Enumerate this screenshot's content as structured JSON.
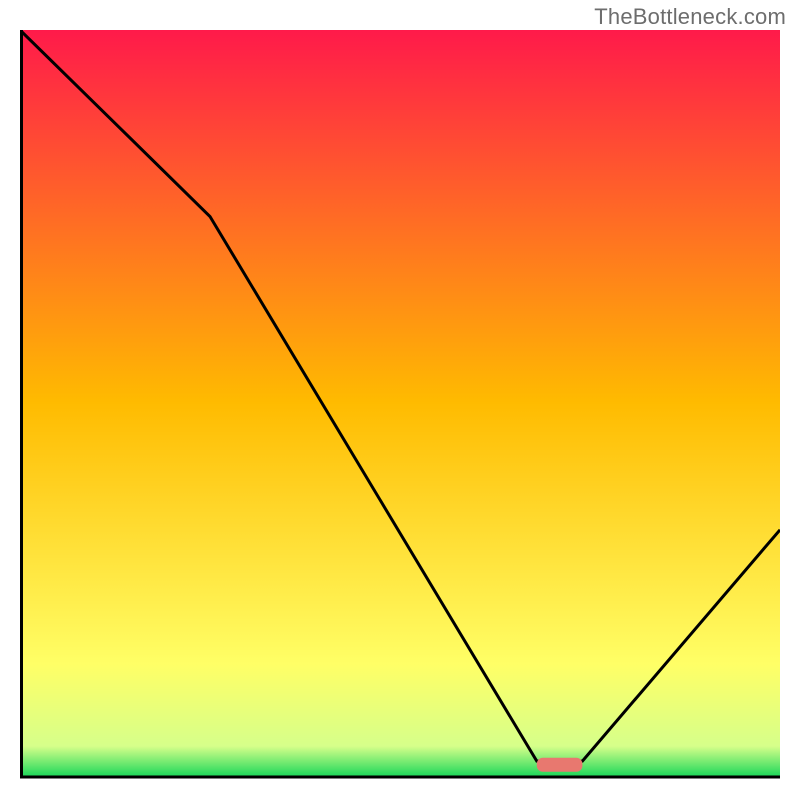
{
  "watermark": "TheBottleneck.com",
  "chart_data": {
    "type": "line",
    "title": "",
    "xlabel": "",
    "ylabel": "",
    "xlim": [
      0,
      100
    ],
    "ylim": [
      0,
      100
    ],
    "x": [
      0,
      25,
      68,
      74,
      100
    ],
    "values": [
      100,
      75,
      2,
      2,
      33
    ],
    "marker": {
      "x_range": [
        68,
        74
      ],
      "y": 1.5,
      "color": "#e8786f"
    },
    "background_gradient": {
      "stops": [
        {
          "offset": 0.0,
          "color": "#ff1a4a"
        },
        {
          "offset": 0.5,
          "color": "#ffbb00"
        },
        {
          "offset": 0.85,
          "color": "#ffff66"
        },
        {
          "offset": 0.96,
          "color": "#d6ff8a"
        },
        {
          "offset": 1.0,
          "color": "#1fd85b"
        }
      ]
    },
    "axes": {
      "color": "#000000",
      "width": 3
    }
  }
}
